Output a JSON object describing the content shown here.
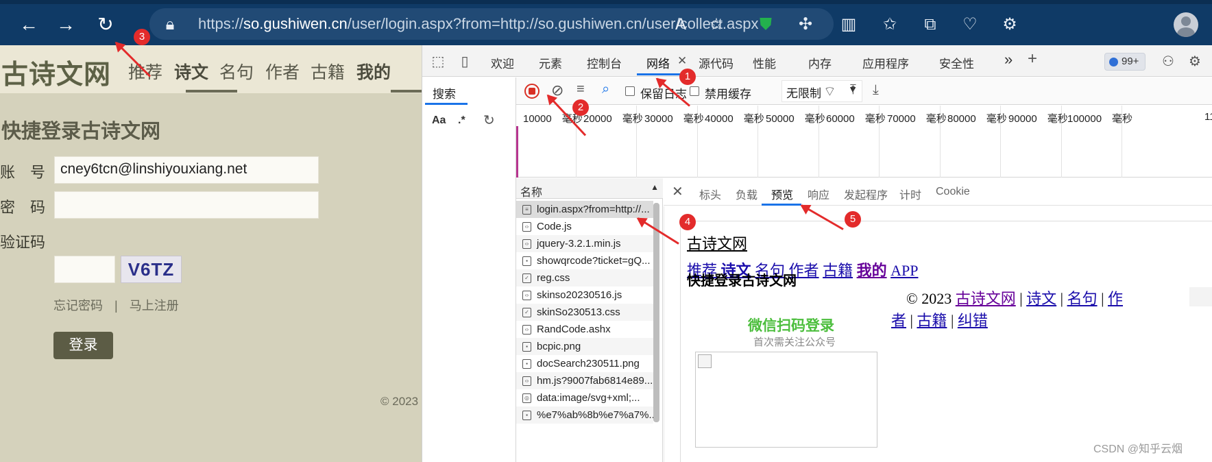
{
  "browser": {
    "url_prefix": "https://",
    "url_domain": "so.gushiwen.cn",
    "url_path": "/user/login.aspx?from=http://so.gushiwen.cn/user/collect.aspx",
    "icons": [
      "back-icon",
      "forward-icon",
      "refresh-icon",
      "lock-icon",
      "read-aloud-icon",
      "favorite-star-icon",
      "shield-extension-icon",
      "extensions-icon",
      "split-screen-icon",
      "favorites-icon",
      "collections-icon",
      "health-icon",
      "performance-icon",
      "profile-avatar"
    ]
  },
  "page": {
    "logo": "古诗文网",
    "nav": [
      "推荐",
      "诗文",
      "名句",
      "作者",
      "古籍",
      "我的"
    ],
    "login_title": "快捷登录古诗文网",
    "account_label": "账　号",
    "account_value": "cney6tcn@linshiyouxiang.net",
    "password_label": "密　码",
    "password_value": "",
    "captcha_label": "验证码",
    "captcha_text": "V6TZ",
    "forgot": "忘记密码",
    "separator": "|",
    "register": "马上注册",
    "login_button": "登录",
    "copyright": "© 2023"
  },
  "devtools": {
    "tabs": [
      "欢迎",
      "元素",
      "控制台",
      "网络",
      "源代码",
      "性能",
      "内存",
      "应用程序",
      "安全性"
    ],
    "more_tabs": "»",
    "add_tab": "+",
    "issues_count": "99+",
    "search_tab": "搜索",
    "search_opts": [
      "Aa",
      ".*"
    ],
    "preserve_log": "保留日志",
    "disable_cache": "禁用缓存",
    "throttling": "无限制",
    "timeline_ticks": [
      "10000　毫秒",
      "20000　毫秒",
      "30000　毫秒",
      "40000　毫秒",
      "50000　毫秒",
      "60000　毫秒",
      "70000　毫秒",
      "80000　毫秒",
      "90000　毫秒",
      "100000　毫秒",
      "11"
    ],
    "name_header": "名称",
    "requests": [
      "login.aspx?from=http://...",
      "Code.js",
      "jquery-3.2.1.min.js",
      "showqrcode?ticket=gQ...",
      "reg.css",
      "skinso20230516.js",
      "skinSo230513.css",
      "RandCode.ashx",
      "bcpic.png",
      "docSearch230511.png",
      "hm.js?9007fab6814e89...",
      "data:image/svg+xml;...",
      "%e7%ab%8b%e7%a7%..."
    ],
    "detail_tabs": [
      "标头",
      "负载",
      "预览",
      "响应",
      "发起程序",
      "计时",
      "Cookie"
    ],
    "preview": {
      "logo_link": "古诗文网",
      "nav1": "推荐",
      "nav2": "诗文",
      "nav3": "名句",
      "nav4": "作者",
      "nav5": "古籍",
      "nav6": "我的",
      "nav7": "APP",
      "title": "快捷登录古诗文网",
      "copy": "© 2023",
      "f1": "古诗文网",
      "f2": "诗文",
      "f3": "名句",
      "f4a": "作",
      "f4b": "者",
      "f5": "古籍",
      "f6": "纠错",
      "sep": "|",
      "wechat": "微信扫码登录",
      "wechat_sub": "首次需关注公众号"
    }
  },
  "markers": [
    "1",
    "2",
    "3",
    "4",
    "5"
  ],
  "watermark": "CSDN @知乎云烟"
}
